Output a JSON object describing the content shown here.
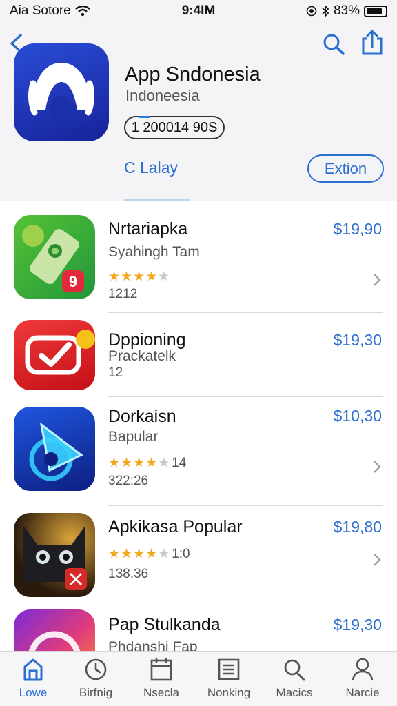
{
  "status_bar": {
    "carrier": "Aia Sotore",
    "time": "9:4IM",
    "battery": "83%",
    "battery_level": 0.83
  },
  "header": {
    "app_name": "App Sndonesia",
    "app_subtitle": "Indoneesia",
    "count": "1 200014 90S",
    "tab_label": "C Lalay",
    "action_label": "Extion"
  },
  "list": [
    {
      "name": "Nrtariapka",
      "subtitle": "Syahingh Tam",
      "price": "$19,90",
      "rating": 4,
      "rating_count": "",
      "meta": "1212"
    },
    {
      "name": "Dppioning",
      "subtitle": "Prackatelk",
      "price": "$19,30",
      "rating": null,
      "rating_count": "",
      "meta": "12"
    },
    {
      "name": "Dorkaisn",
      "subtitle": "Bapular",
      "price": "$10,30",
      "rating": 4,
      "rating_count": "14",
      "meta": "322:26"
    },
    {
      "name": "Apkikasa Popular",
      "subtitle": "",
      "price": "$19,80",
      "rating": 4,
      "rating_count": "1:0",
      "meta": "138.36"
    },
    {
      "name": "Pap Stulkanda",
      "subtitle": "Phdanshi Fap",
      "price": "$19,30",
      "rating": null,
      "rating_count": "",
      "meta": ""
    }
  ],
  "tabs": [
    {
      "label": "Lowe",
      "icon": "home-icon",
      "active": true
    },
    {
      "label": "Birfnig",
      "icon": "clock-icon",
      "active": false
    },
    {
      "label": "Nsecla",
      "icon": "calendar-icon",
      "active": false
    },
    {
      "label": "Nonking",
      "icon": "list-icon",
      "active": false
    },
    {
      "label": "Macics",
      "icon": "search-icon",
      "active": false
    },
    {
      "label": "Narcie",
      "icon": "person-icon",
      "active": false
    }
  ],
  "colors": {
    "accent": "#2b6fcf",
    "star": "#f0a81c",
    "header_bg": "#f4f4f6"
  }
}
